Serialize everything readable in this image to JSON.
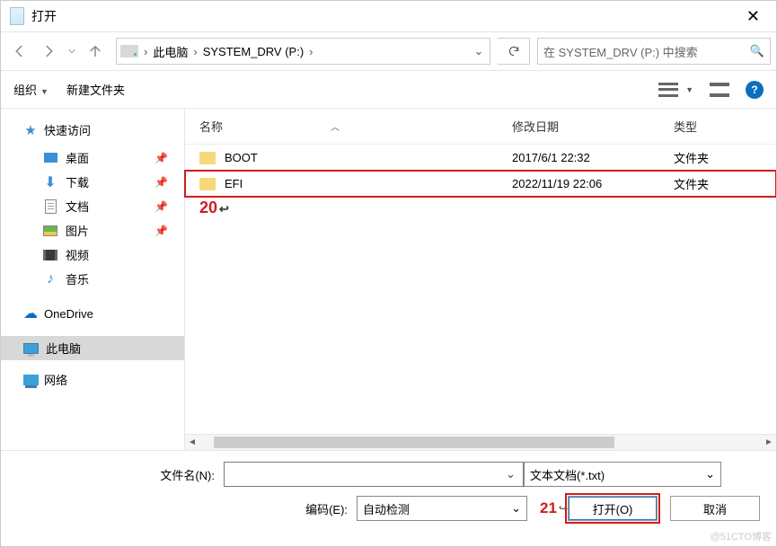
{
  "title": "打开",
  "breadcrumb": {
    "root": "此电脑",
    "drive": "SYSTEM_DRV (P:)"
  },
  "search_placeholder": "在 SYSTEM_DRV (P:) 中搜索",
  "toolbar": {
    "organize": "组织",
    "new_folder": "新建文件夹"
  },
  "sidebar": {
    "quick_access": "快速访问",
    "desktop": "桌面",
    "downloads": "下载",
    "documents": "文档",
    "pictures": "图片",
    "videos": "视频",
    "music": "音乐",
    "onedrive": "OneDrive",
    "this_pc": "此电脑",
    "network": "网络"
  },
  "columns": {
    "name": "名称",
    "date": "修改日期",
    "type": "类型"
  },
  "files": [
    {
      "name": "BOOT",
      "date": "2017/6/1 22:32",
      "type": "文件夹"
    },
    {
      "name": "EFI",
      "date": "2022/11/19 22:06",
      "type": "文件夹"
    }
  ],
  "annotations": {
    "a20": "20",
    "a21": "21"
  },
  "bottom": {
    "filename_label": "文件名(N):",
    "filetype": "文本文档(*.txt)",
    "encoding_label": "编码(E):",
    "encoding_value": "自动检测",
    "open_btn": "打开(O)",
    "cancel_btn": "取消"
  },
  "watermark": "@51CTO博客"
}
